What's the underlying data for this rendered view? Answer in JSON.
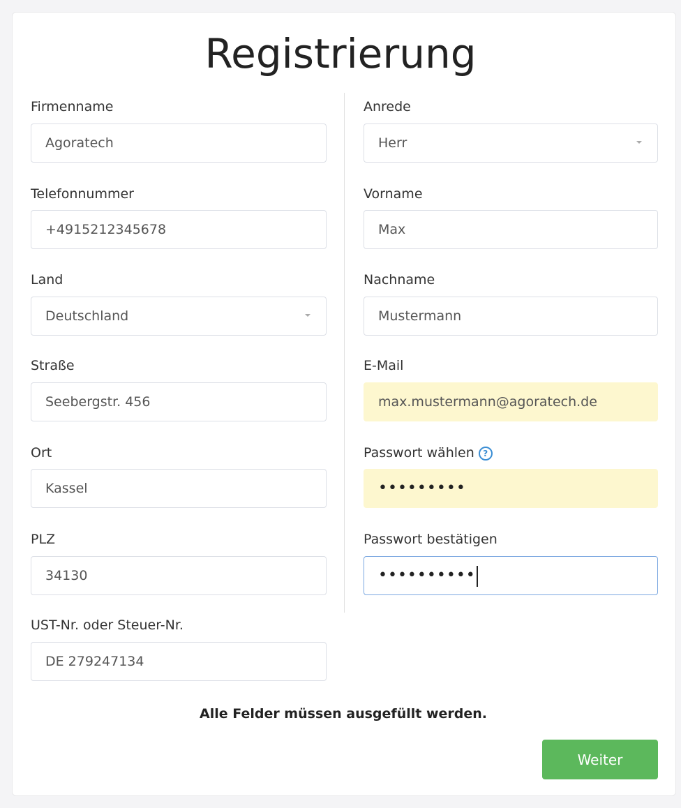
{
  "title": "Registrierung",
  "left_fields": [
    {
      "label": "Firmenname",
      "value": "Agoratech"
    },
    {
      "label": "Telefonnummer",
      "value": "+4915212345678"
    },
    {
      "label": "Land",
      "value": "Deutschland"
    },
    {
      "label": "Straße",
      "value": "Seebergstr. 456"
    },
    {
      "label": "Ort",
      "value": "Kassel"
    },
    {
      "label": "PLZ",
      "value": "34130"
    },
    {
      "label": "UST-Nr. oder Steuer-Nr.",
      "value": "DE 279247134"
    }
  ],
  "right_fields": [
    {
      "label": "Anrede",
      "value": "Herr"
    },
    {
      "label": "Vorname",
      "value": "Max"
    },
    {
      "label": "Nachname",
      "value": "Mustermann"
    },
    {
      "label": "E-Mail",
      "value": "max.mustermann@agoratech.de"
    },
    {
      "label": "Passwort wählen",
      "value": "•••••••••"
    },
    {
      "label": "Passwort bestätigen",
      "value": "••••••••••"
    }
  ],
  "help_icon": {
    "symbol": "?",
    "icon": "question-circle-icon",
    "color": "#3b8ed4"
  },
  "notice": "Alle Felder müssen ausgefüllt werden.",
  "submit_label": "Weiter",
  "colors": {
    "button": "#5cb85c",
    "autofill": "#fdf7cf",
    "focus_border": "#7aa7e0"
  }
}
